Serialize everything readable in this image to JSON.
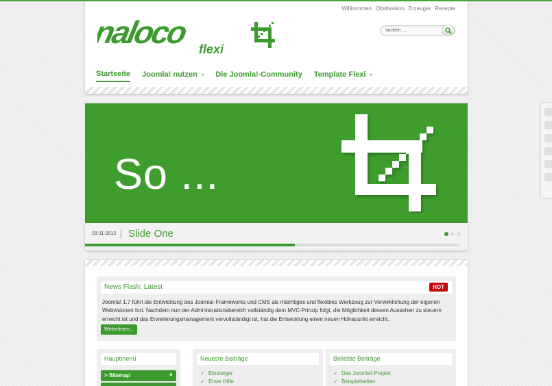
{
  "header": {
    "top_links": [
      "Willkommen",
      "Obstlexikon",
      "Erzeuger",
      "Rezepte"
    ],
    "logo_text": "naloco",
    "logo_sub": "flexi",
    "search_placeholder": "suchen ..."
  },
  "nav": {
    "items": [
      {
        "label": "Startseite",
        "has_submenu": false,
        "active": true
      },
      {
        "label": "Joomla! nutzen",
        "has_submenu": true,
        "active": false
      },
      {
        "label": "Die Joomla!-Community",
        "has_submenu": false,
        "active": false
      },
      {
        "label": "Template Flexi",
        "has_submenu": true,
        "active": false
      }
    ],
    "submenu_marker": "v"
  },
  "slider": {
    "text": "So ...",
    "date": "29-11-2012",
    "title": "Slide One",
    "progress": 0.56,
    "dots": 3,
    "active_dot": 0
  },
  "news": {
    "title": "News Flash: Latest",
    "badge": "HOT",
    "body": "Joomla! 1.7 führt die Entwicklung des Joomla!-Frameworks und CMS als mächtiges und flexibles Werkzeug zur Verwirklichung der eigenen Webvisionen fort. Nachdem nun der Administrationsbereich vollständig dem MVC-Prinzip folgt, die Möglichkeit dessen Aussehen zu steuern erreicht ist und das Erweiterungsmanagement vervollständigt ist, hat die Entwicklung einen neuen Höhepunkt erreicht.",
    "more": "Weiterlesen..."
  },
  "modules": {
    "menu": {
      "title": "Hauptmenü",
      "item": "> Sitemap",
      "item_icon": "★"
    },
    "latest": {
      "title": "Neueste Beiträge",
      "items": [
        "Einsteiger",
        "Erste Hilfe"
      ]
    },
    "popular": {
      "title": "Beliebte Beiträge",
      "items": [
        "Das Joomla!-Projekt",
        "Beispielseiten"
      ]
    }
  },
  "colors": {
    "accent": "#3d9a2f",
    "hot": "#c0070e"
  }
}
